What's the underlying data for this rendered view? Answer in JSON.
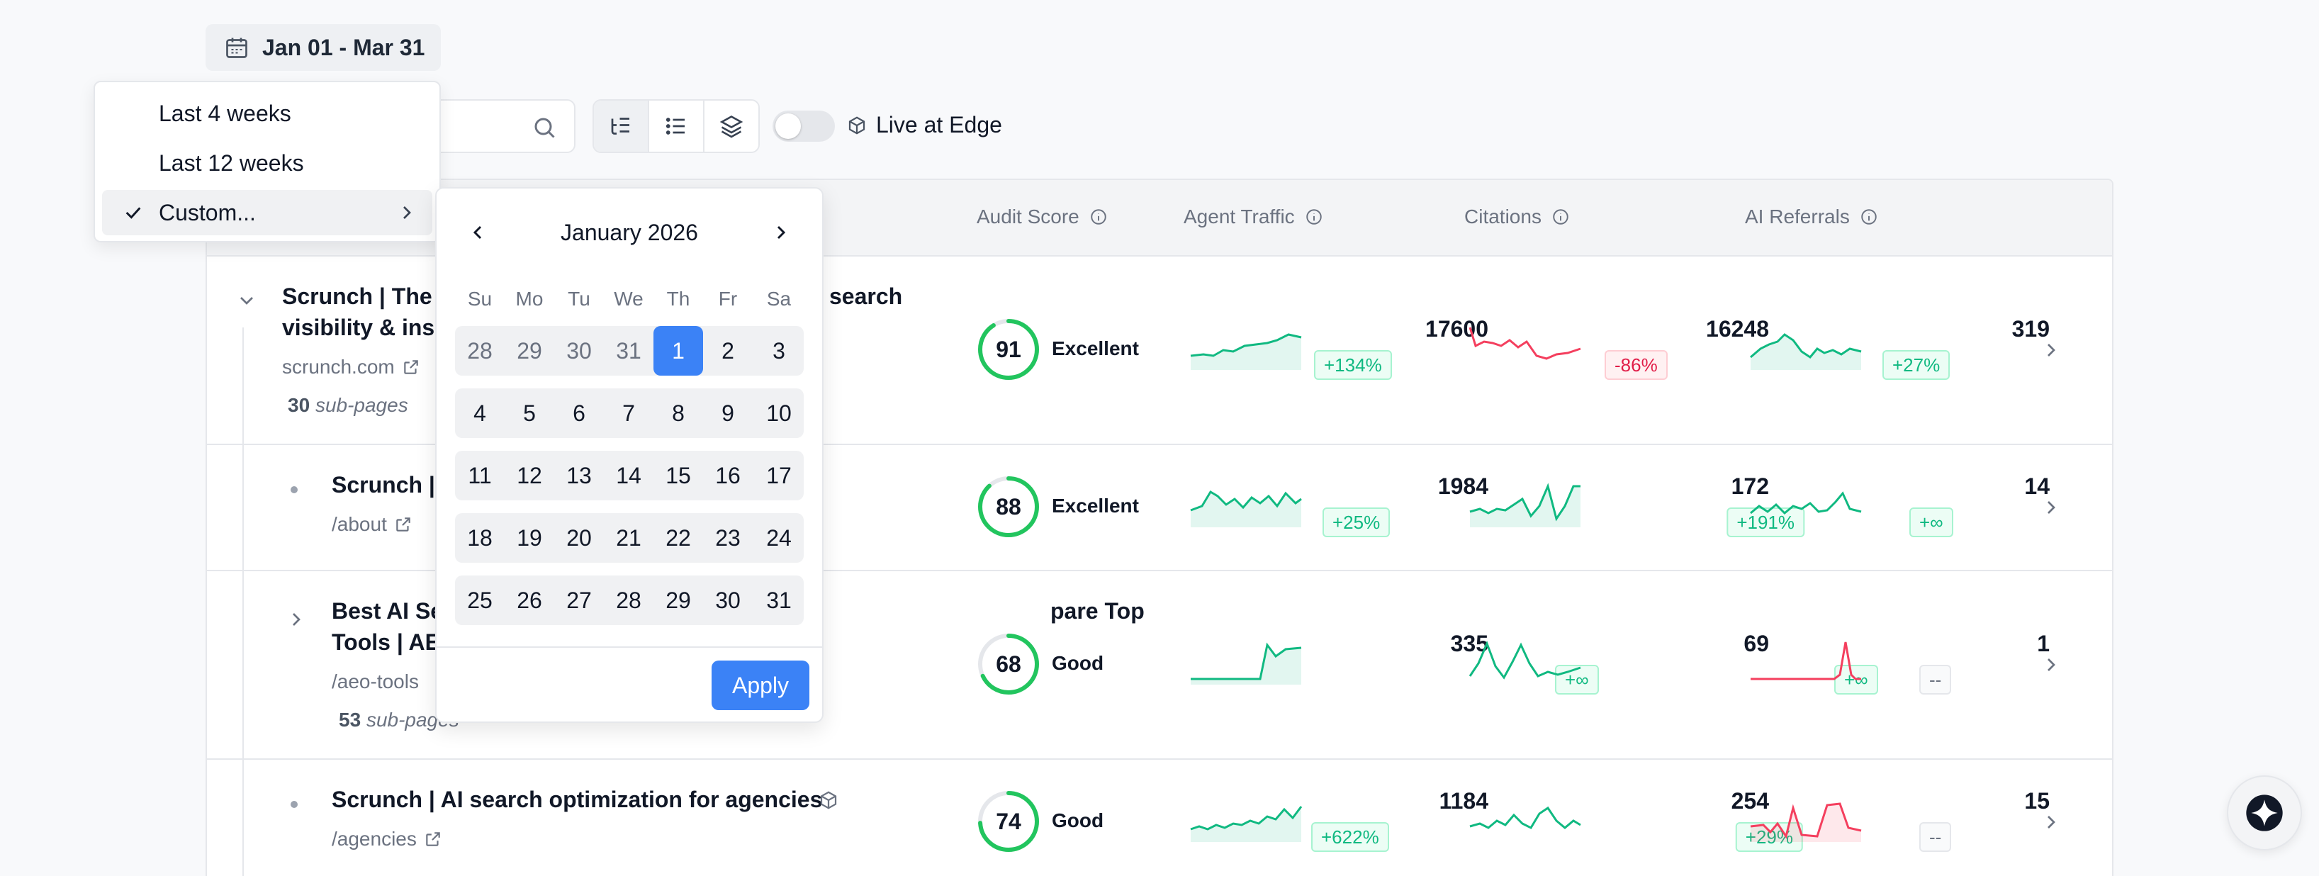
{
  "date_range": {
    "label": "Jan 01 - Mar 31",
    "icon": "calendar-icon"
  },
  "menu": {
    "items": [
      {
        "label": "Last 4 weeks",
        "selected": false
      },
      {
        "label": "Last 12 weeks",
        "selected": false
      },
      {
        "label": "Custom...",
        "selected": true
      }
    ]
  },
  "calendar": {
    "month_label": "January 2026",
    "weekdays": [
      "Su",
      "Mo",
      "Tu",
      "We",
      "Th",
      "Fr",
      "Sa"
    ],
    "weeks": [
      [
        "28",
        "29",
        "30",
        "31",
        "1",
        "2",
        "3"
      ],
      [
        "4",
        "5",
        "6",
        "7",
        "8",
        "9",
        "10"
      ],
      [
        "11",
        "12",
        "13",
        "14",
        "15",
        "16",
        "17"
      ],
      [
        "18",
        "19",
        "20",
        "21",
        "22",
        "23",
        "24"
      ],
      [
        "25",
        "26",
        "27",
        "28",
        "29",
        "30",
        "31"
      ]
    ],
    "selected_day": "1",
    "apply_label": "Apply"
  },
  "toolbar": {
    "live_label": "Live at Edge",
    "live_enabled": false
  },
  "columns": {
    "audit": "Audit Score",
    "traffic": "Agent Traffic",
    "citations": "Citations",
    "referrals": "AI Referrals"
  },
  "colors": {
    "accent": "#3b82f6",
    "positive": "#10b981",
    "negative": "#e11d48",
    "good_score": "#22c55e"
  },
  "rows": [
    {
      "title_line1": "Scrunch | The",
      "title_tail": "search",
      "title_line2": "visibility & insig",
      "path": "scrunch.com",
      "subpages_count": "30",
      "subpages_label": "sub-pages",
      "score": "91",
      "score_label": "Excellent",
      "traffic": "17600",
      "traffic_delta": "+134%",
      "citations": "16248",
      "citations_delta": "-86%",
      "referrals": "319",
      "referrals_delta": "+27%"
    },
    {
      "title_line1": "Scrunch |",
      "path": "/about",
      "score": "88",
      "score_label": "Excellent",
      "traffic": "1984",
      "traffic_delta": "+25%",
      "citations": "172",
      "citations_delta": "+191%",
      "referrals": "14",
      "referrals_delta": "+∞"
    },
    {
      "title_line1": "Best AI Se",
      "title_tail": "pare Top",
      "title_line2": "Tools | AE",
      "path": "/aeo-tools",
      "subpages_count": "53",
      "subpages_label": "sub-pages",
      "score": "68",
      "score_label": "Good",
      "traffic": "335",
      "traffic_delta": "+∞",
      "citations": "69",
      "citations_delta": "+∞",
      "referrals": "1",
      "referrals_delta": "--"
    },
    {
      "title_line1": "Scrunch | AI search optimization for agencies",
      "path": "/agencies",
      "score": "74",
      "score_label": "Good",
      "traffic": "1184",
      "traffic_delta": "+622%",
      "citations": "254",
      "citations_delta": "+29%",
      "referrals": "15",
      "referrals_delta": "--"
    }
  ]
}
